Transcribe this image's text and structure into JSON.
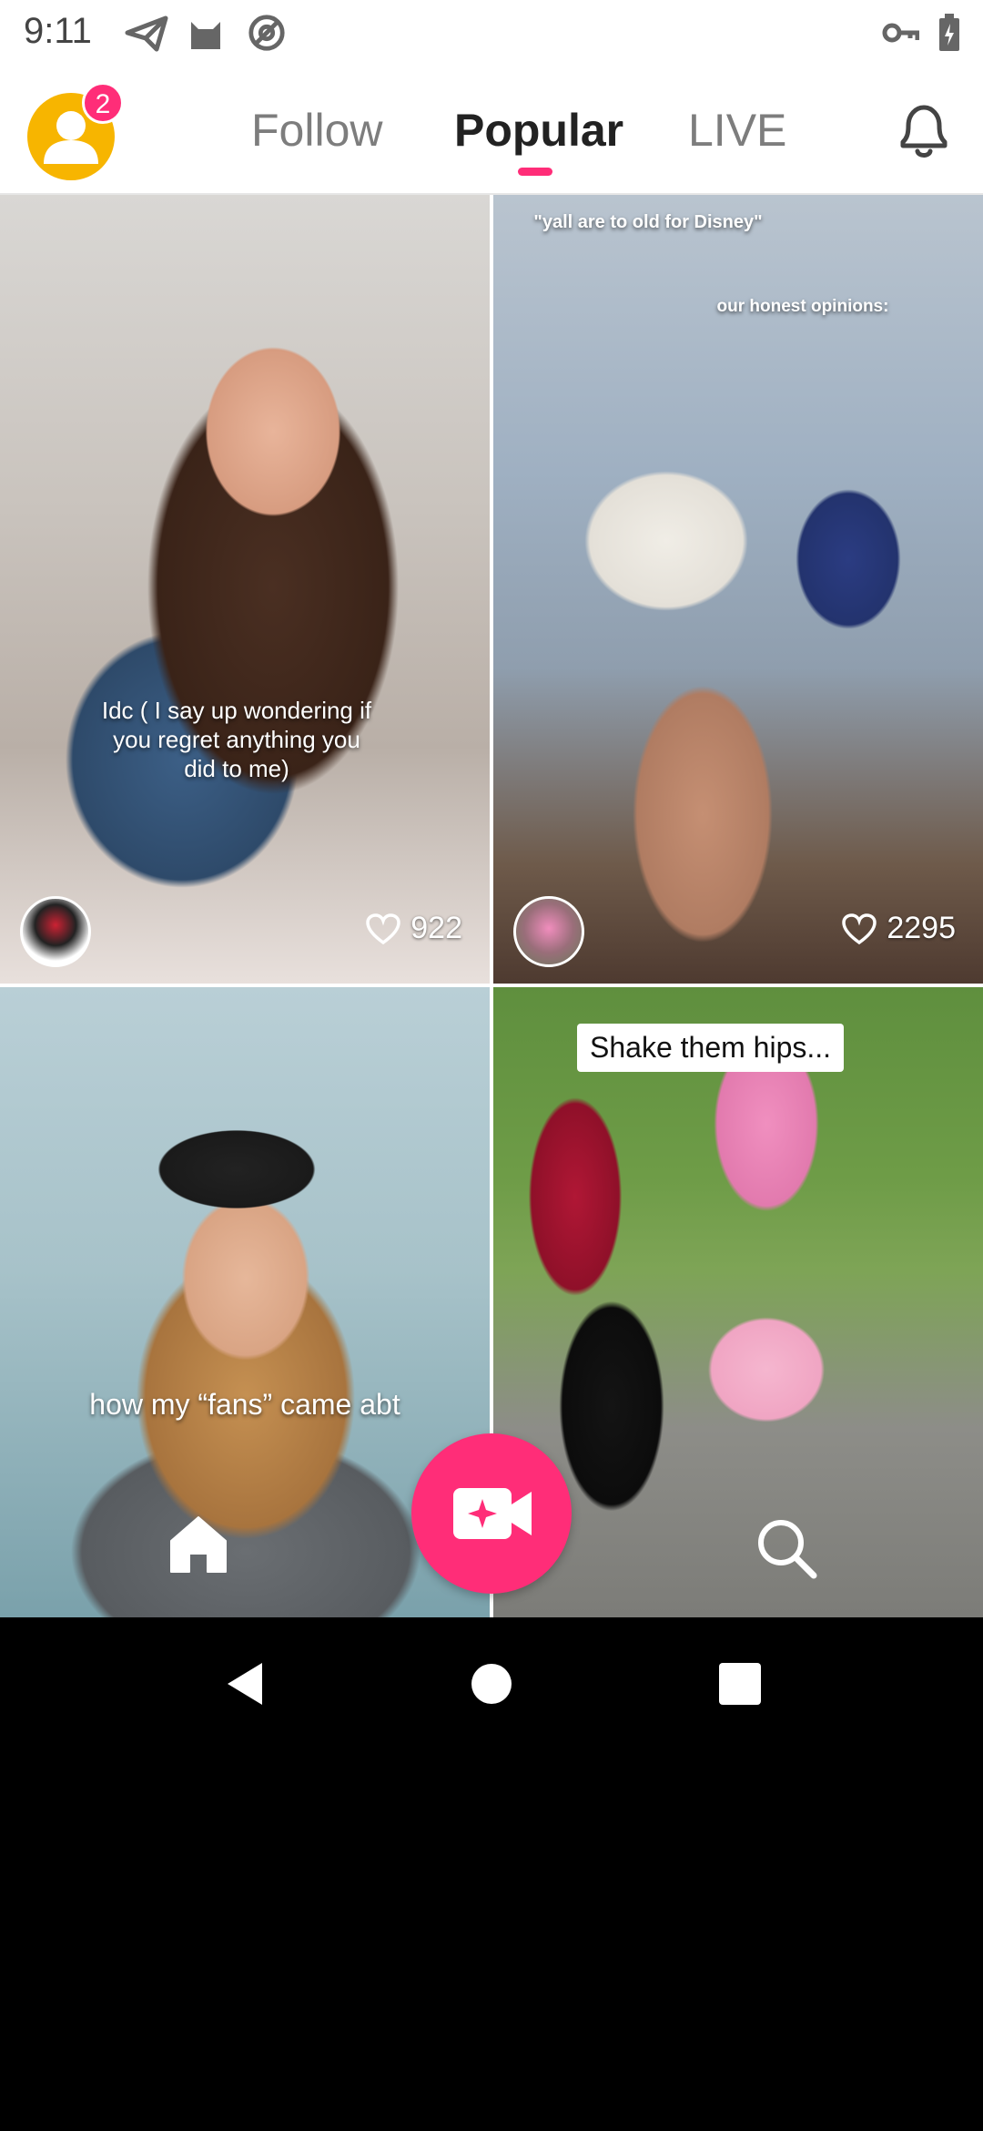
{
  "status_bar": {
    "time": "9:11",
    "left_icons": [
      "send-icon",
      "cat-icon",
      "at-sign-icon"
    ],
    "right_icons": [
      "key-icon",
      "battery-charging-icon"
    ]
  },
  "header": {
    "notification_count": "2",
    "tabs": [
      {
        "label": "Follow",
        "active": false
      },
      {
        "label": "Popular",
        "active": true
      },
      {
        "label": "LIVE",
        "active": false
      }
    ],
    "accent_color": "#ff2d78"
  },
  "feed": {
    "cards": [
      {
        "caption": "Idc ( I say up wondering if you regret anything you did to me)",
        "likes": "922"
      },
      {
        "caption_top": "\"yall are to old for Disney\"",
        "caption_sub": "our honest opinions:",
        "likes": "2295"
      },
      {
        "caption": "how my “fans” came abt"
      },
      {
        "caption": "Shake them hips..."
      }
    ]
  },
  "bottom_nav": {
    "items": [
      "home-icon",
      "record-video-icon",
      "search-icon"
    ]
  },
  "system_nav": [
    "back-icon",
    "home-circle-icon",
    "recents-icon"
  ]
}
